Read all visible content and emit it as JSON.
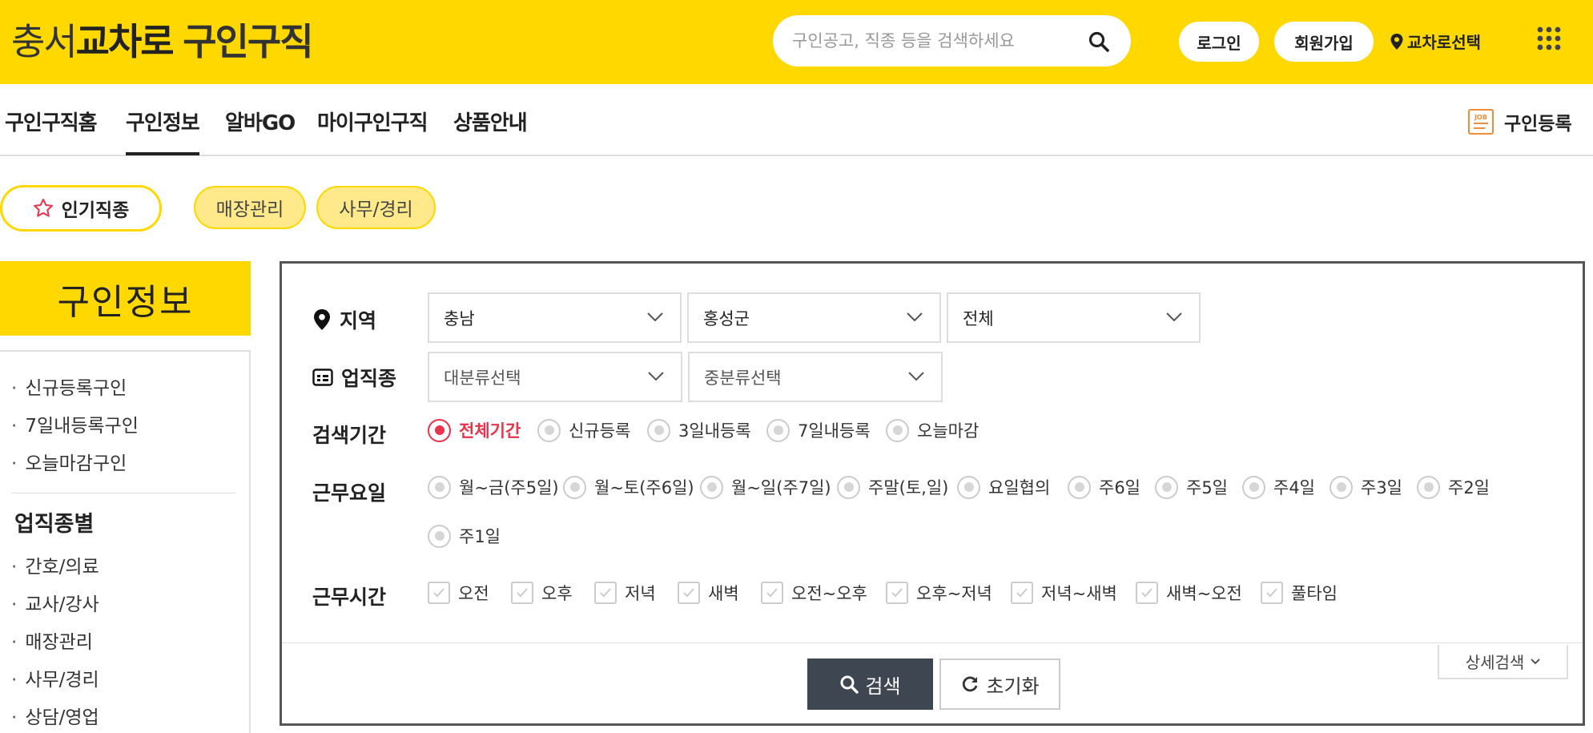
{
  "header": {
    "logo_part1": "충서",
    "logo_part2": "교차로",
    "logo_part3": "구인구직",
    "search_placeholder": "구인공고, 직종 등을 검색하세요",
    "login": "로그인",
    "signup": "회원가입",
    "location": "교차로선택",
    "brand_color": "#ffd800"
  },
  "nav": {
    "items": [
      "구인구직홈",
      "구인정보",
      "알바GO",
      "마이구인구직",
      "상품안내"
    ],
    "active_index": 1,
    "register": "구인등록"
  },
  "chips": {
    "popular": "인기직종",
    "items": [
      "매장관리",
      "사무/경리"
    ]
  },
  "sidebar": {
    "title": "구인정보",
    "items": [
      "신규등록구인",
      "7일내등록구인",
      "오늘마감구인"
    ],
    "category_title": "업직종별",
    "categories": [
      "간호/의료",
      "교사/강사",
      "매장관리",
      "사무/경리",
      "상담/영업"
    ]
  },
  "filters": {
    "region_label": "지역",
    "region_selects": [
      "충남",
      "홍성군",
      "전체"
    ],
    "job_label": "업직종",
    "job_selects": [
      "대분류선택",
      "중분류선택"
    ],
    "period_label": "검색기간",
    "period_options": [
      "전체기간",
      "신규등록",
      "3일내등록",
      "7일내등록",
      "오늘마감"
    ],
    "period_selected": "전체기간",
    "days_label": "근무요일",
    "days_options": [
      "월~금(주5일)",
      "월~토(주6일)",
      "월~일(주7일)",
      "주말(토,일)",
      "요일협의",
      "주6일",
      "주5일",
      "주4일",
      "주3일",
      "주2일",
      "주1일"
    ],
    "time_label": "근무시간",
    "time_options": [
      "오전",
      "오후",
      "저녁",
      "새벽",
      "오전~오후",
      "오후~저녁",
      "저녁~새벽",
      "새벽~오전",
      "풀타임"
    ],
    "search_button": "검색",
    "reset_button": "초기화",
    "detail_button": "상세검색",
    "accent_color": "#e8334a"
  }
}
